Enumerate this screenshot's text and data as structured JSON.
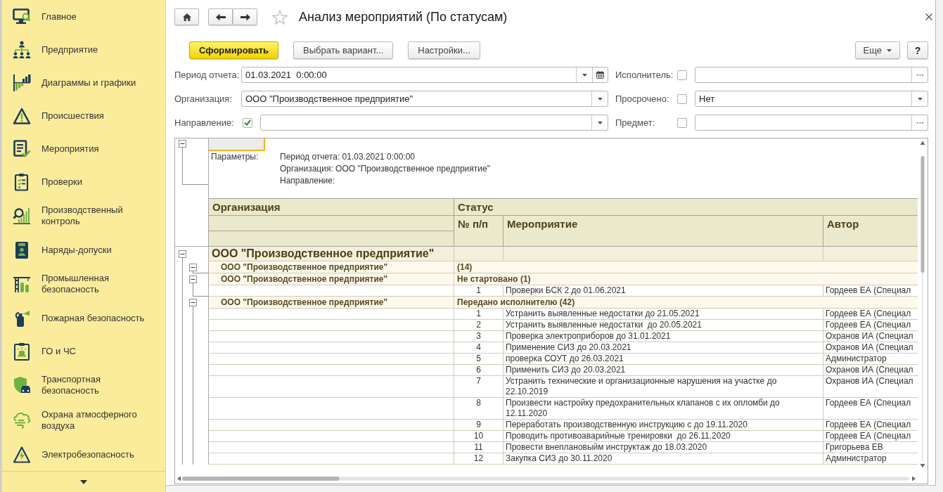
{
  "sidebar": {
    "items": [
      {
        "label": "Главное"
      },
      {
        "label": "Предприятие"
      },
      {
        "label": "Диаграммы и графики"
      },
      {
        "label": "Происшествия"
      },
      {
        "label": "Мероприятия"
      },
      {
        "label": "Проверки"
      },
      {
        "label": "Производственный контроль"
      },
      {
        "label": "Наряды-допуски"
      },
      {
        "label": "Промышленная безопасность"
      },
      {
        "label": "Пожарная безопасность"
      },
      {
        "label": "ГО и ЧС"
      },
      {
        "label": "Транспортная безопасность"
      },
      {
        "label": "Охрана атмосферного воздуха"
      },
      {
        "label": "Электробезопасность"
      }
    ]
  },
  "window": {
    "title": "Анализ мероприятий (По статусам)"
  },
  "command_bar": {
    "buttons": [
      {
        "label": "Сформировать",
        "kind": "primary"
      },
      {
        "label": "Выбрать вариант...",
        "kind": "plain"
      },
      {
        "label": "Настройки...",
        "kind": "plain"
      }
    ],
    "more": "Еще",
    "help": "?"
  },
  "filters": {
    "left": [
      {
        "label": "Период отчета:",
        "kind": "date",
        "value": "01.03.2021  0:00:00"
      },
      {
        "label": "Организация:",
        "kind": "select",
        "value": "ООО \"Производственное предприятие\""
      },
      {
        "label": "Направление:",
        "kind": "select",
        "checked": true
      }
    ],
    "right": [
      {
        "label": "Исполнитель:",
        "kind": "lookup",
        "checked": false
      },
      {
        "label": "Просрочено:",
        "kind": "select",
        "checked": false,
        "value": "Нет"
      },
      {
        "label": "Предмет:",
        "kind": "lookup",
        "checked": false
      }
    ]
  },
  "report": {
    "current_cell": {
      "selected": true
    },
    "parameters": {
      "expanded": true,
      "label": "Параметры:",
      "lines": [
        "Период отчета: 01.03.2021 0:00:00",
        "Организация: ООО \"Производственное предприятие\"",
        "Направление:"
      ]
    },
    "columns": [
      {
        "label": "Организация"
      },
      {
        "label": "Статус",
        "children": [
          {
            "label": "№ п/п"
          },
          {
            "label": "Мероприятие"
          },
          {
            "label": "Автор"
          }
        ]
      }
    ],
    "groups": [
      {
        "organization": "ООО \"Производственное предприятие\"",
        "expanded": true,
        "children": [
          {
            "organization": "ООО \"Производственное предприятие\"",
            "status": "(14)",
            "expanded": true
          },
          {
            "organization": "ООО \"Производственное предприятие\"",
            "status": "Не стартовано (1)",
            "expanded": true,
            "rows": [
              {
                "number": "1",
                "activity": "Проверки БСК 2 до 01.06.2021",
                "author": "Гордеев ЕА (Специал"
              }
            ]
          },
          {
            "organization": "ООО \"Производственное предприятие\"",
            "status": "Передано исполнителю (42)",
            "expanded": true,
            "rows": [
              {
                "number": "1",
                "activity": "Устранить выявленные недостатки до 21.05.2021",
                "author": "Гордеев ЕА (Специал"
              },
              {
                "number": "2",
                "activity": "Устранить выявленные недостатки  до 20.05.2021",
                "author": "Гордеев ЕА (Специал"
              },
              {
                "number": "3",
                "activity": "Проверка электроприборов до 31.01.2021",
                "author": "Охранов ИА (Специал"
              },
              {
                "number": "4",
                "activity": "Применение СИЗ до 20.03.2021",
                "author": "Охранов ИА (Специал"
              },
              {
                "number": "5",
                "activity": "проверка СОУТ до 26.03.2021",
                "author": "Администратор"
              },
              {
                "number": "6",
                "activity": "Применить СИЗ до 20.03.2021",
                "author": "Охранов ИА (Специал"
              },
              {
                "number": "7",
                "activity": "Устранить технические и организационные нарушения на участке до 22.10.2019",
                "author": "Охранов ИА (Специал"
              },
              {
                "number": "8",
                "activity": "Произвести настройку предохранительных клапанов с их опломби до 12.11.2020",
                "author": "Гордеев ЕА (Специал"
              },
              {
                "number": "9",
                "activity": "Переработать производственную инструкцию с до 19.11.2020",
                "author": "Гордеев ЕА (Специал"
              },
              {
                "number": "10",
                "activity": "Проводить противоаварийные тренировки  до 26.11.2020",
                "author": "Гордеев ЕА (Специал"
              },
              {
                "number": "11",
                "activity": "Провести внеплановыйм инструктаж до 18.03.2020",
                "author": "Григорьева ЕВ"
              },
              {
                "number": "12",
                "activity": "Закупка СИЗ до 30.11.2020",
                "author": "Администратор"
              }
            ]
          }
        ]
      }
    ]
  }
}
